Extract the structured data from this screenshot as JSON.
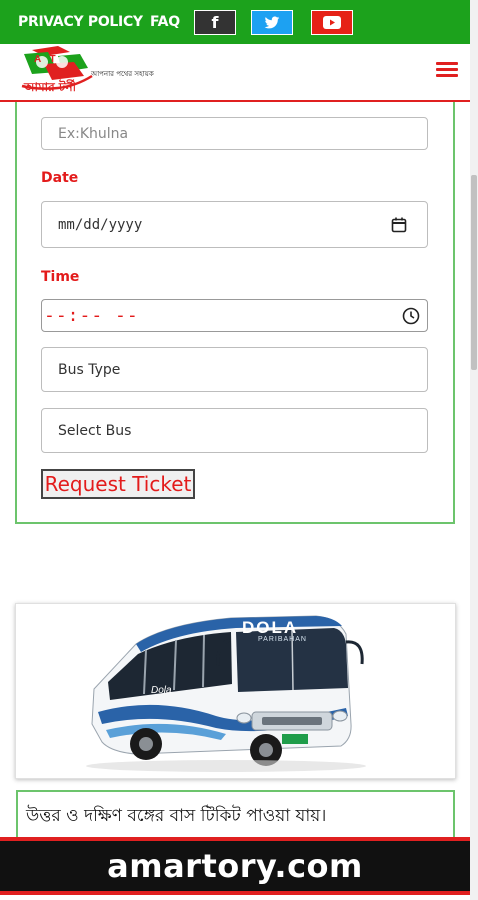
{
  "topbar": {
    "privacy_label": "PRIVACY POLICY",
    "faq_label": "FAQ",
    "social": [
      {
        "name": "facebook",
        "glyph": "f",
        "color": "#333333"
      },
      {
        "name": "twitter",
        "glyph": "bird",
        "color": "#1da1f2"
      },
      {
        "name": "youtube",
        "glyph": "play",
        "color": "#e62117"
      }
    ]
  },
  "header": {
    "logo_badge": "AT",
    "logo_text": "আমার টর্নী",
    "tagline": "আপনার পথের সহায়ক",
    "menu_icon": "hamburger-icon"
  },
  "form": {
    "from_placeholder": "Ex:Khulna",
    "date_label": "Date",
    "date_value": "mm/dd/yyyy",
    "time_label": "Time",
    "time_value": "--:-- --",
    "bus_type_placeholder": "Bus Type",
    "select_bus_placeholder": "Select Bus",
    "submit_label": "Request Ticket"
  },
  "bus": {
    "brand": "DOLA",
    "sub": "PARIBAHAN",
    "side": "Dola"
  },
  "info_text": "উত্তর ও দক্ষিণ বঙ্গের বাস টিকিট পাওয়া যায়।",
  "banner_text": "amartory.com",
  "colors": {
    "green": "#1ca21c",
    "red": "#e31b1b",
    "border_green": "#6cc46c"
  }
}
